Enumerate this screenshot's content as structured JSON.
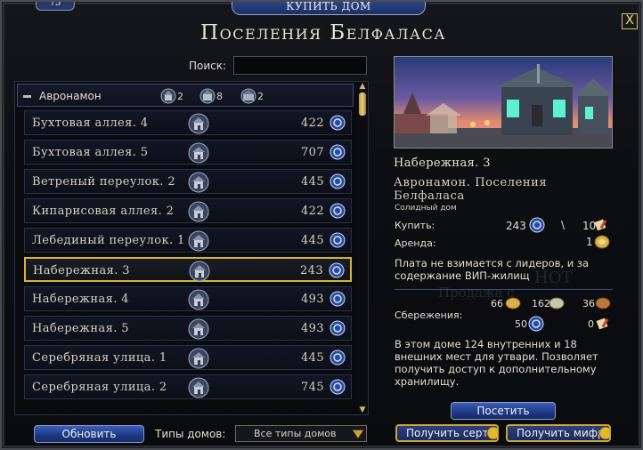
{
  "window": {
    "corner_number": "75",
    "tab_title": "КУПИТЬ ДОМ",
    "close_label": "X",
    "title": "Поселения Белфаласа"
  },
  "search": {
    "label": "Поиск:",
    "value": ""
  },
  "group": {
    "name": "Авронамон",
    "counts": [
      {
        "icon": "house-type-1-icon",
        "value": "2"
      },
      {
        "icon": "house-type-2-icon",
        "value": "8"
      },
      {
        "icon": "house-type-3-icon",
        "value": "2"
      }
    ]
  },
  "rows": [
    {
      "name": "Бухтовая аллея. 4",
      "price": "422",
      "selected": false
    },
    {
      "name": "Бухтовая аллея. 5",
      "price": "707",
      "selected": false
    },
    {
      "name": "Ветреный переулок. 2",
      "price": "445",
      "selected": false
    },
    {
      "name": "Кипарисовая аллея. 2",
      "price": "422",
      "selected": false
    },
    {
      "name": "Лебединый переулок. 1",
      "price": "445",
      "selected": false
    },
    {
      "name": "Набережная. 3",
      "price": "243",
      "selected": true
    },
    {
      "name": "Набережная. 4",
      "price": "493",
      "selected": false
    },
    {
      "name": "Набережная. 5",
      "price": "493",
      "selected": false
    },
    {
      "name": "Серебряная улица. 1",
      "price": "445",
      "selected": false
    },
    {
      "name": "Серебряная улица. 2",
      "price": "745",
      "selected": false
    }
  ],
  "buttons": {
    "refresh": "Обновить",
    "visit": "Посетить",
    "get_cert": "Получить серти",
    "get_mithril": "Получить мифр"
  },
  "house_types": {
    "label": "Типы домов:",
    "selected": "Все типы домов"
  },
  "detail": {
    "name": "Набережная. 3",
    "location": "Авронамон. Поселения Белфаласа",
    "type": "Солидный дом",
    "buy_label": "Купить:",
    "buy_price": "243",
    "buy_separator": "\\",
    "buy_alt": "10",
    "rent_label": "Аренда:",
    "rent_value": "1",
    "fee_note": "Плата не взимается с лидеров, и за содержание ВИП-жилищ",
    "savings_label": "Сбережения:",
    "savings": [
      "66",
      "162",
      "36",
      "50",
      "0"
    ],
    "storage_note": "В этом доме 124 внутренних и 18 внешних мест для утвари. Позволяет получить доступ к дополнительному хранилищу."
  },
  "colors": {
    "accent_gold": "#d7b530",
    "button_blue": "#1f3a86",
    "row_border": "#27304a"
  }
}
